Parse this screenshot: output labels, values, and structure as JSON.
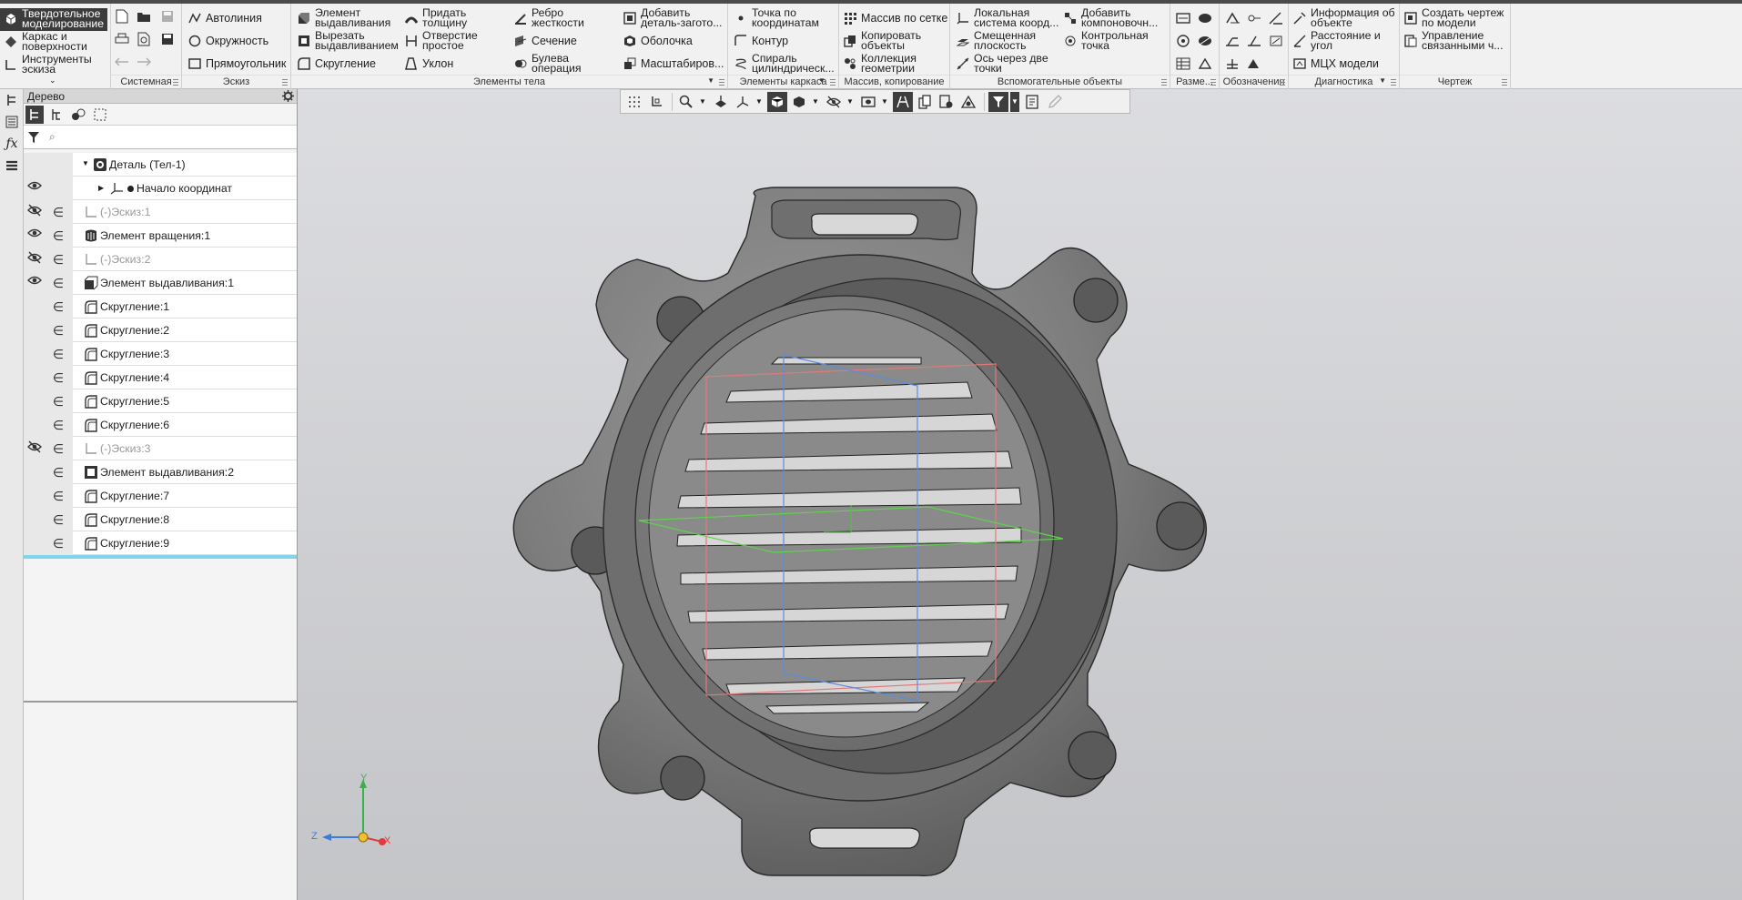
{
  "ribbon": {
    "modes": [
      {
        "label": "Твердотельное моделирование",
        "icon": "solid-cube-icon",
        "active": true
      },
      {
        "label": "Каркас и поверхности",
        "icon": "surface-icon"
      },
      {
        "label": "Инструменты эскиза",
        "icon": "sketch-tools-icon"
      }
    ],
    "groups": {
      "system": "Системная",
      "sketch": "Эскиз",
      "body": "Элементы тела",
      "frame": "Элементы каркаса",
      "array": "Массив, копирование",
      "aux": "Вспомогательные объекты",
      "dims": "Разме...",
      "notes": "Обозначения",
      "diag": "Диагностика",
      "drawing": "Чертеж"
    },
    "sketch_items": [
      "Автолиния",
      "Окружность",
      "Прямоугольник"
    ],
    "body_items": [
      "Элемент выдавливания",
      "Вырезать выдавливанием",
      "Скругление",
      "Придать толщину",
      "Отверстие простое",
      "Уклон",
      "Ребро жесткости",
      "Сечение",
      "Булева операция",
      "Добавить деталь-загото...",
      "Оболочка",
      "Масштабиров..."
    ],
    "frame_items": [
      "Точка по координатам",
      "Контур",
      "Спираль цилиндрическ..."
    ],
    "array_items": [
      "Массив по сетке",
      "Копировать объекты",
      "Коллекция геометрии"
    ],
    "aux_items": [
      "Локальная система коорд...",
      "Смещенная плоскость",
      "Ось через две точки",
      "Добавить компоновочн...",
      "Контрольная точка"
    ],
    "diag_items": [
      "Информация об объекте",
      "Расстояние и угол",
      "МЦХ модели"
    ],
    "drawing_items": [
      "Создать чертеж по модели",
      "Управление связанными ч..."
    ]
  },
  "tree": {
    "panel_title": "Дерево",
    "search_placeholder": "",
    "root": "Деталь (Тел-1)",
    "items": [
      {
        "label": "Начало координат",
        "eye": "visible",
        "include": false,
        "icon": "origin-icon",
        "level": 2
      },
      {
        "label": "(-)Эскиз:1",
        "eye": "hidden",
        "include": true,
        "icon": "sketch-icon",
        "dim": true
      },
      {
        "label": "Элемент вращения:1",
        "eye": "visible",
        "include": true,
        "icon": "revolve-icon"
      },
      {
        "label": "(-)Эскиз:2",
        "eye": "hidden",
        "include": true,
        "icon": "sketch-icon",
        "dim": true
      },
      {
        "label": "Элемент выдавливания:1",
        "eye": "visible",
        "include": true,
        "icon": "extrude-icon"
      },
      {
        "label": "Скругление:1",
        "eye": "",
        "include": true,
        "icon": "fillet-icon"
      },
      {
        "label": "Скругление:2",
        "eye": "",
        "include": true,
        "icon": "fillet-icon"
      },
      {
        "label": "Скругление:3",
        "eye": "",
        "include": true,
        "icon": "fillet-icon"
      },
      {
        "label": "Скругление:4",
        "eye": "",
        "include": true,
        "icon": "fillet-icon"
      },
      {
        "label": "Скругление:5",
        "eye": "",
        "include": true,
        "icon": "fillet-icon"
      },
      {
        "label": "Скругление:6",
        "eye": "",
        "include": true,
        "icon": "fillet-icon"
      },
      {
        "label": "(-)Эскиз:3",
        "eye": "hidden",
        "include": true,
        "icon": "sketch-icon",
        "dim": true
      },
      {
        "label": "Элемент выдавливания:2",
        "eye": "",
        "include": true,
        "icon": "cut-extrude-icon"
      },
      {
        "label": "Скругление:7",
        "eye": "",
        "include": true,
        "icon": "fillet-icon"
      },
      {
        "label": "Скругление:8",
        "eye": "",
        "include": true,
        "icon": "fillet-icon"
      },
      {
        "label": "Скругление:9",
        "eye": "",
        "include": true,
        "icon": "fillet-icon"
      }
    ]
  },
  "axes": {
    "x": "X",
    "y": "Y",
    "z": "Z"
  },
  "colors": {
    "accent": "#3c3c3c",
    "tree_end": "#7fd6ec",
    "axis_x": "#e23b3b",
    "axis_y": "#37b24d",
    "axis_z": "#3b7ddd",
    "model": "#7b7b7b"
  }
}
